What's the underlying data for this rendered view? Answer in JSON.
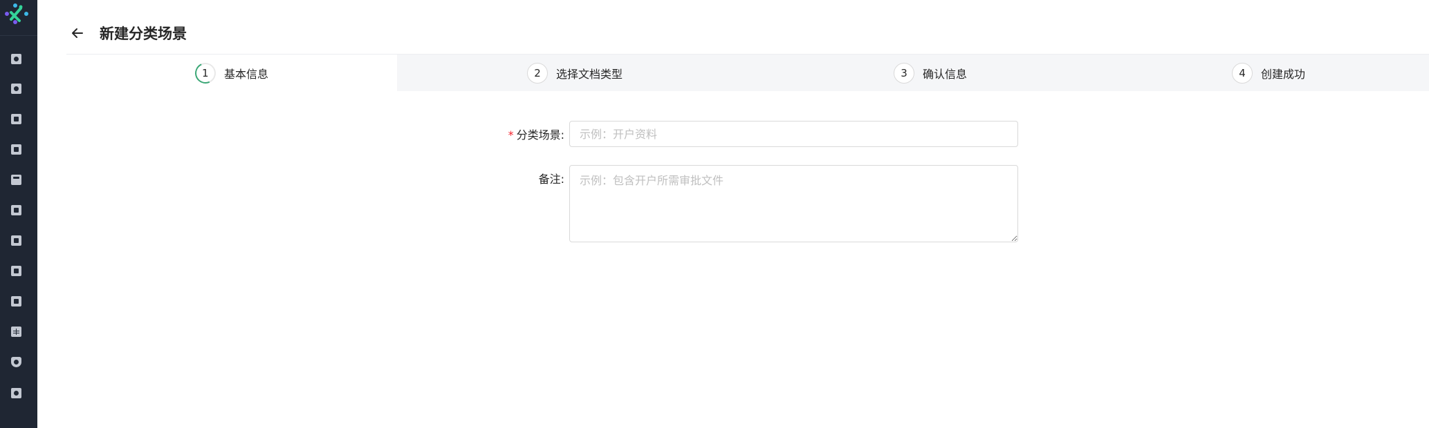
{
  "header": {
    "title": "新建分类场景"
  },
  "steps": [
    {
      "num": "1",
      "label": "基本信息",
      "active": true
    },
    {
      "num": "2",
      "label": "选择文档类型",
      "active": false
    },
    {
      "num": "3",
      "label": "确认信息",
      "active": false
    },
    {
      "num": "4",
      "label": "创建成功",
      "active": false
    }
  ],
  "form": {
    "scene": {
      "required_mark": "*",
      "label": "分类场景:",
      "value": "",
      "placeholder": "示例：开户资料"
    },
    "remark": {
      "label": "备注:",
      "value": "",
      "placeholder": "示例：包含开户所需审批文件"
    }
  },
  "sidebar": {
    "items": [
      "document-icon",
      "upload-icon",
      "stamp-icon",
      "scan-icon",
      "text-icon",
      "folder-icon",
      "edit-icon",
      "compare-icon",
      "book-icon",
      "table-icon",
      "shield-icon",
      "settings-doc-icon"
    ]
  },
  "colors": {
    "sidebar": "#1f2633",
    "accent": "#3ba776",
    "required": "#f5222d"
  }
}
